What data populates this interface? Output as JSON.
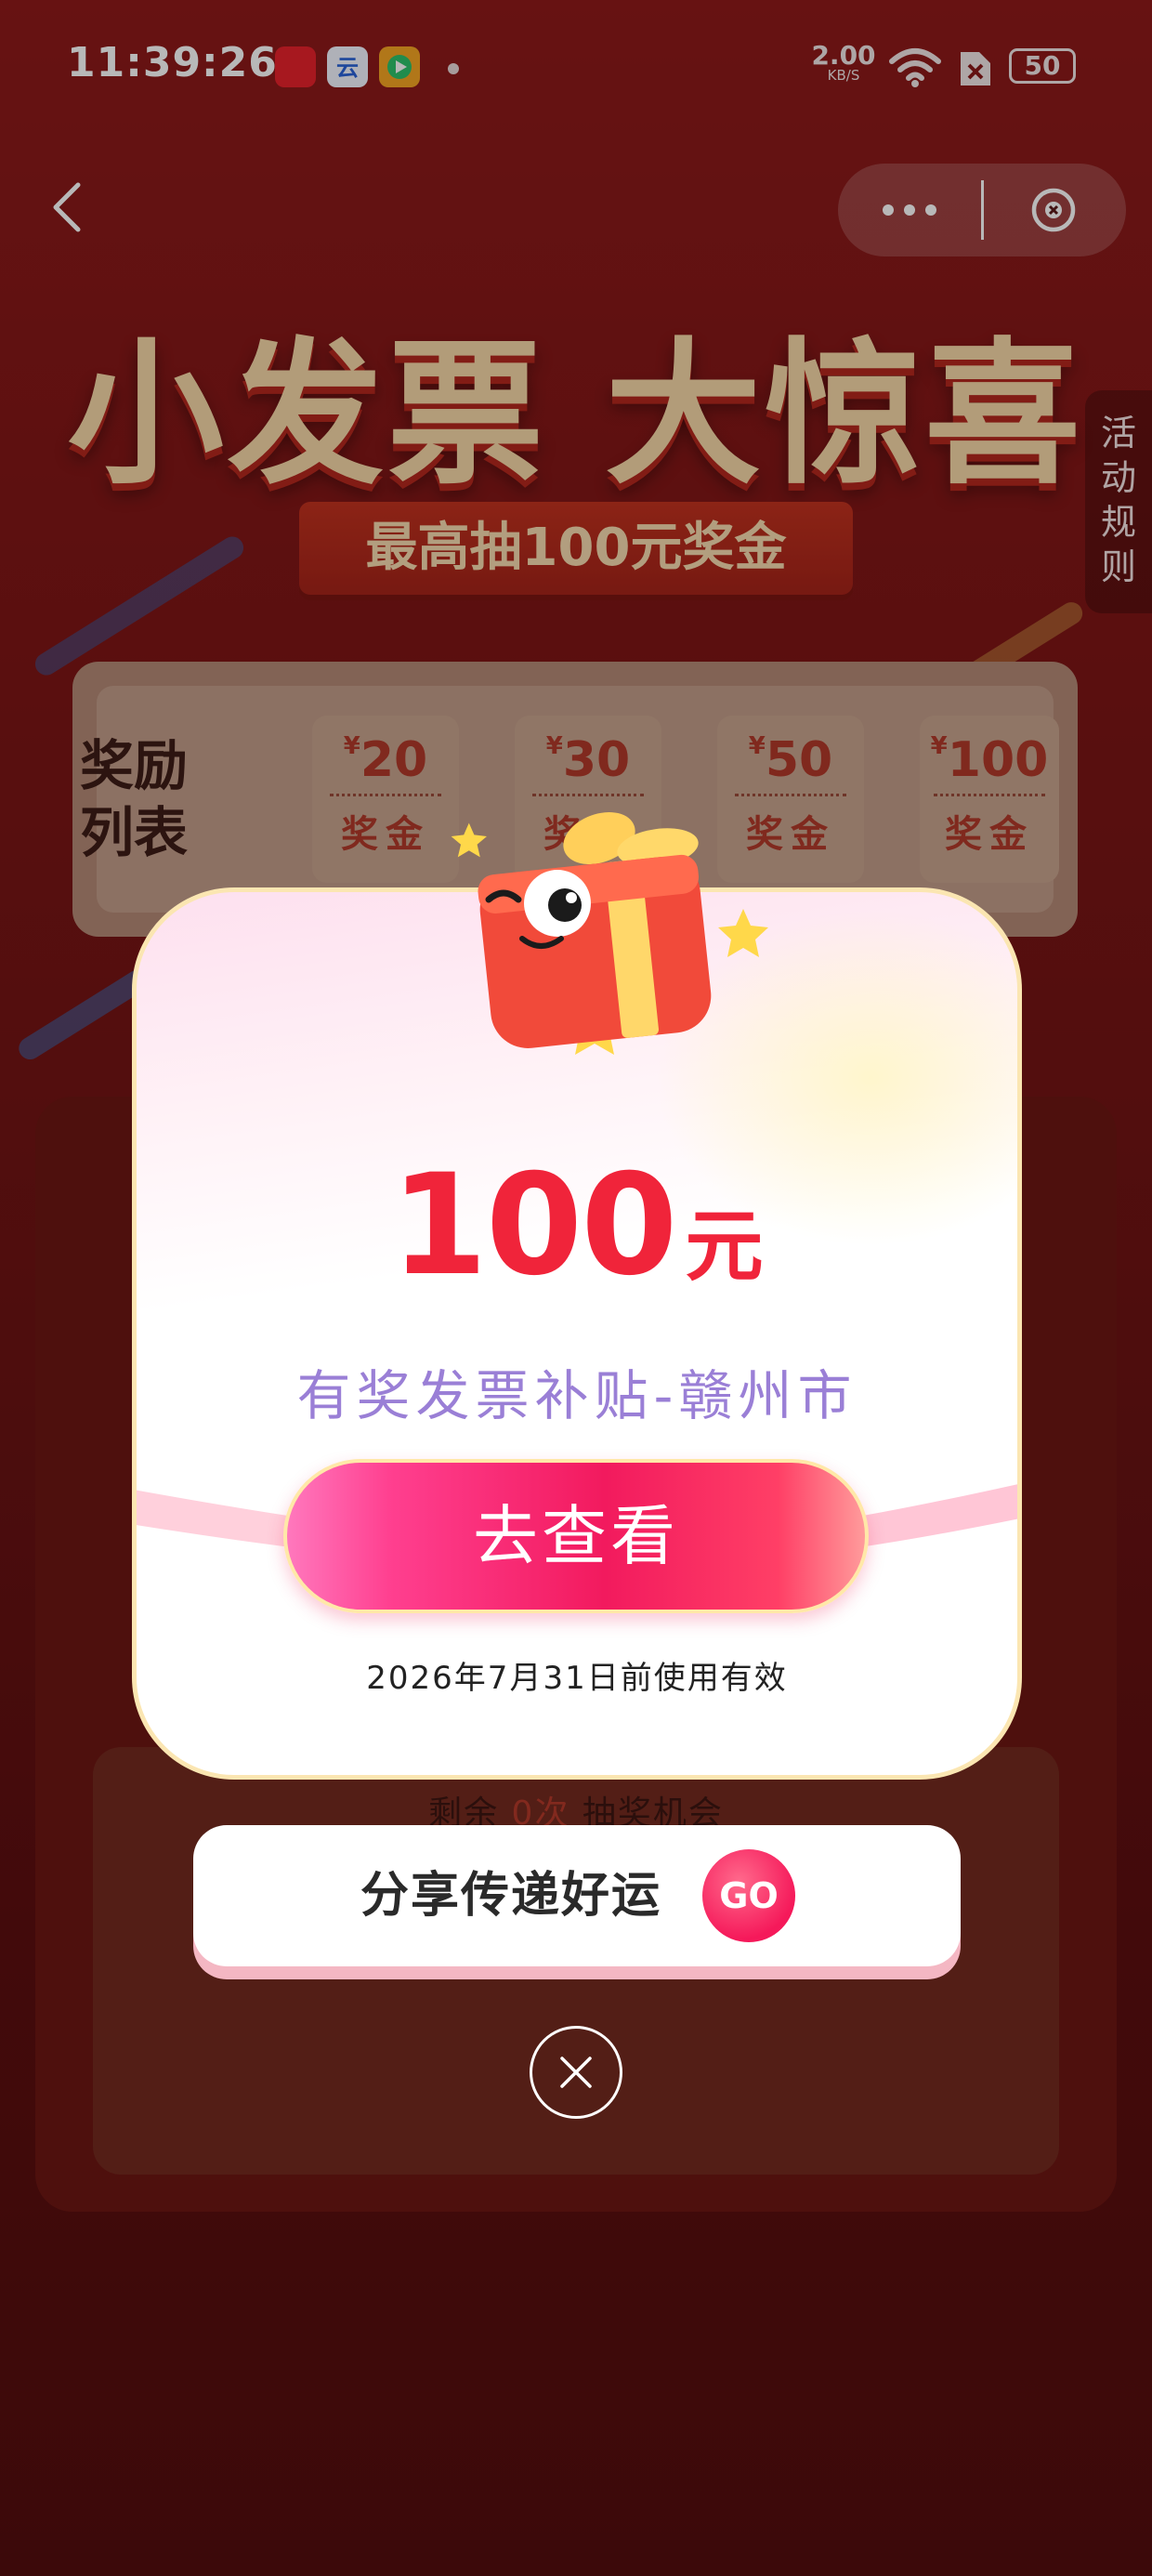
{
  "status_bar": {
    "time": "11:39:26",
    "net_speed_value": "2.00",
    "net_speed_unit": "KB/S",
    "battery": "50",
    "icons": [
      "app-red-payment-icon",
      "app-blue-cloud-icon",
      "app-video-icon",
      "notification-dot-icon",
      "wifi-icon",
      "sim-no-signal-icon",
      "battery-icon"
    ]
  },
  "nav": {
    "back_icon": "chevron-left-icon",
    "more_icon": "more-dots-icon",
    "close_icon": "close-circle-icon"
  },
  "background": {
    "title": "小发票 大惊喜",
    "subtitle": "最高抽100元奖金",
    "rules_tab": "活动规则",
    "reward_list_label": "奖励列表",
    "currency_symbol": "¥",
    "prize_word": "奖金",
    "prizes": [
      "20",
      "30",
      "50",
      "100"
    ],
    "chances_prefix": "剩余",
    "chances_count": "0次",
    "chances_suffix": "抽奖机会"
  },
  "modal": {
    "amount": "100",
    "unit": "元",
    "subsidy_name": "有奖发票补贴-赣州市",
    "view_button": "去查看",
    "validity": "2026年7月31日前使用有效",
    "illustration_icon": "gift-box-mascot-icon"
  },
  "share": {
    "label": "分享传递好运",
    "go_button": "GO"
  },
  "close_icon": "close-icon",
  "colors": {
    "amount_red": "#f0243a",
    "subsidy_purple": "#9a7fd6",
    "button_pink": "#f21a5e",
    "background_red": "#7e1616"
  }
}
